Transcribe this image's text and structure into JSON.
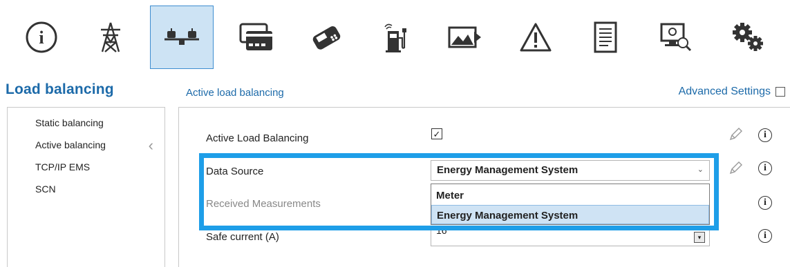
{
  "toolbar": {
    "icons": [
      "info-icon",
      "power-tower-icon",
      "load-balancing-icon",
      "payment-cards-icon",
      "card-terminal-icon",
      "charging-station-icon",
      "image-icon",
      "warning-icon",
      "document-icon",
      "computer-diagnostics-icon",
      "gears-icon"
    ],
    "active_index": 2
  },
  "sidebar": {
    "title": "Load balancing",
    "items": [
      {
        "label": "Static balancing"
      },
      {
        "label": "Active balancing",
        "selected": true
      },
      {
        "label": "TCP/IP EMS"
      },
      {
        "label": "SCN"
      }
    ]
  },
  "main": {
    "section_title": "Active load balancing",
    "advanced_settings_label": "Advanced Settings",
    "advanced_settings_checked": false,
    "rows": {
      "active_load_balancing": {
        "label": "Active Load Balancing",
        "checked": true,
        "check_glyph": "✓"
      },
      "data_source": {
        "label": "Data Source",
        "value": "Energy Management System",
        "options": [
          "Meter",
          "Energy Management System"
        ],
        "selected_option": "Energy Management System"
      },
      "received_measurements": {
        "label": "Received Measurements"
      },
      "safe_current": {
        "label": "Safe current (A)",
        "value": "16"
      }
    },
    "info_glyph": "i",
    "dropdown_arrow": "⌄",
    "spin_glyph": "▾"
  },
  "colors": {
    "accent_blue": "#1c6aa9",
    "highlight_frame": "#1e9ee8",
    "active_tab_bg": "#cde3f4"
  }
}
